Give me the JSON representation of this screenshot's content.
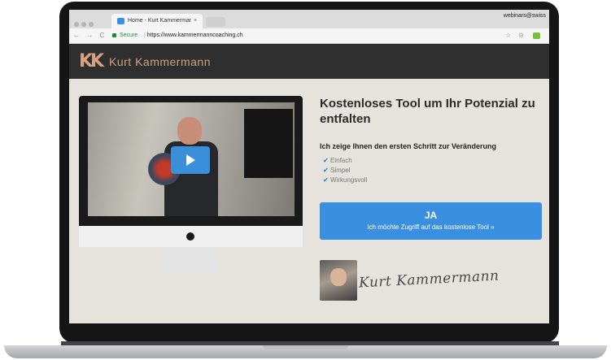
{
  "browser": {
    "tab_title": "Home - Kurt Kammermann Co",
    "tab_close": "×",
    "profile": "webinars@swiss",
    "secure_label": "Secure",
    "url": "https://www.kammermanncoaching.ch",
    "nav_glyphs": "← → C",
    "icons": [
      "favicon-icon",
      "lock-icon",
      "star-icon",
      "extension-icon",
      "extension-green-icon"
    ]
  },
  "site": {
    "brand": "Kurt Kammermann",
    "logo_glyph": "KK",
    "headline": "Kostenloses Tool um Ihr Potenzial zu entfalten",
    "subheadline": "Ich zeige Ihnen den ersten Schritt zur Veränderung",
    "features": [
      "Einfach",
      "Simpel",
      "Wirkungsvoll"
    ],
    "check_glyph": "✔",
    "cta": {
      "main": "JA",
      "sub": "Ich möchte Zugriff auf das kostenlose Tool »"
    },
    "signature": "Kurt Kammermann"
  },
  "colors": {
    "accent": "#3b8fe0",
    "brand": "#d5a281",
    "header_bg": "#2f2f2f",
    "page_bg": "#e6e3dc"
  }
}
